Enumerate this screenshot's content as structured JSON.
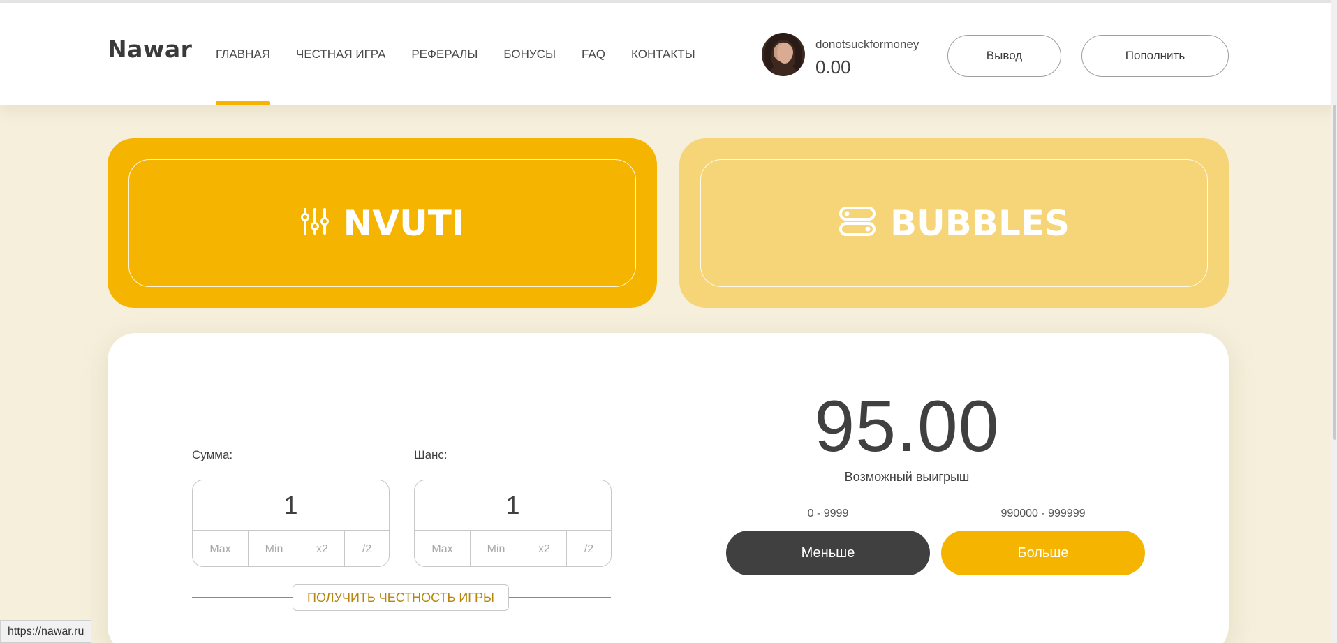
{
  "header": {
    "logo": "Nawar",
    "nav": [
      "ГЛАВНАЯ",
      "ЧЕСТНАЯ ИГРА",
      "РЕФЕРАЛЫ",
      "БОНУСЫ",
      "FAQ",
      "КОНТАКТЫ"
    ],
    "active_nav": "ГЛАВНАЯ",
    "username": "donotsuckformoney",
    "balance": "0.00",
    "withdraw_label": "Вывод",
    "deposit_label": "Пополнить"
  },
  "games": {
    "nvuti": {
      "label": "NVUTI",
      "icon": "sliders-icon",
      "active": true
    },
    "bubbles": {
      "label": "BUBBLES",
      "icon": "bubbles-icon",
      "active": false
    }
  },
  "bet": {
    "sum_label": "Сумма:",
    "sum_value": "1",
    "chance_label": "Шанс:",
    "chance_value": "1",
    "controls": [
      "Max",
      "Min",
      "x2",
      "/2"
    ],
    "fairness_label": "ПОЛУЧИТЬ ЧЕСТНОСТЬ ИГРЫ"
  },
  "result": {
    "win_value": "95.00",
    "win_label": "Возможный выигрыш",
    "less_range": "0 - 9999",
    "more_range": "990000 - 999999",
    "less_label": "Меньше",
    "more_label": "Больше"
  },
  "status_bar": {
    "url": "https://nawar.ru"
  },
  "colors": {
    "accent": "#f5b400",
    "accent_light": "#f5d577",
    "dark": "#404040",
    "background": "#f5efdc"
  }
}
